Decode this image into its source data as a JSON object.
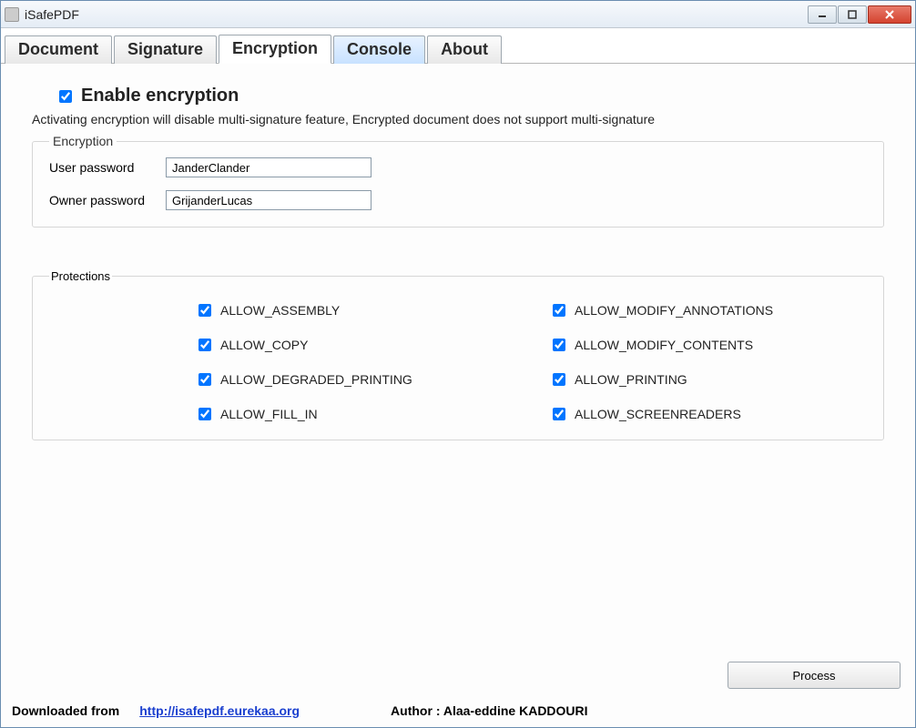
{
  "window": {
    "title": "iSafePDF"
  },
  "tabs": [
    {
      "label": "Document",
      "active": false
    },
    {
      "label": "Signature",
      "active": false
    },
    {
      "label": "Encryption",
      "active": true
    },
    {
      "label": "Console",
      "active": false,
      "cls": "console"
    },
    {
      "label": "About",
      "active": false
    }
  ],
  "enable": {
    "label": "Enable encryption",
    "checked": true,
    "note": "Activating encryption will disable multi-signature feature, Encrypted document does not support multi-signature"
  },
  "encryption": {
    "legend": "Encryption",
    "user_password_label": "User password",
    "user_password_value": "JanderClander",
    "owner_password_label": "Owner password",
    "owner_password_value": "GrijanderLucas"
  },
  "protections": {
    "legend": "Protections",
    "items": [
      {
        "label": "ALLOW_ASSEMBLY",
        "checked": true
      },
      {
        "label": "ALLOW_MODIFY_ANNOTATIONS",
        "checked": true
      },
      {
        "label": "ALLOW_COPY",
        "checked": true
      },
      {
        "label": "ALLOW_MODIFY_CONTENTS",
        "checked": true
      },
      {
        "label": "ALLOW_DEGRADED_PRINTING",
        "checked": true
      },
      {
        "label": "ALLOW_PRINTING",
        "checked": true
      },
      {
        "label": "ALLOW_FILL_IN",
        "checked": true
      },
      {
        "label": "ALLOW_SCREENREADERS",
        "checked": true
      }
    ]
  },
  "process_button": "Process",
  "footer": {
    "downloaded_label": "Downloaded from",
    "url": "http://isafepdf.eurekaa.org",
    "author_label": "Author : ",
    "author_name": "Alaa-eddine KADDOURI"
  }
}
